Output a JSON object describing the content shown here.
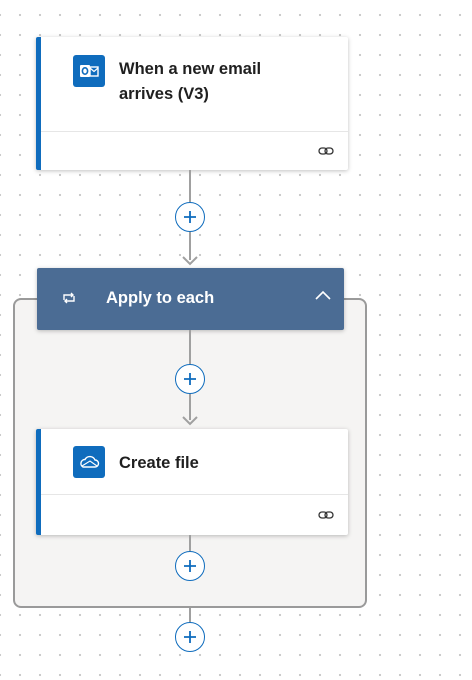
{
  "trigger": {
    "title": "When a new email arrives (V3)",
    "title_line1": "When a new email",
    "title_line2": "arrives (V3)",
    "icon": "outlook-icon",
    "footer_icon": "link-icon"
  },
  "loop": {
    "title": "Apply to each",
    "icon": "loop-icon",
    "collapse_icon": "chevron-up-icon"
  },
  "action": {
    "title": "Create file",
    "icon": "onedrive-icon",
    "footer_icon": "link-icon"
  },
  "add_step_icon": "plus-icon",
  "colors": {
    "accent": "#0f6cbd",
    "scope_header": "#4b6c94",
    "scope_bg": "#f5f4f3",
    "connector": "#a0a0a0"
  }
}
